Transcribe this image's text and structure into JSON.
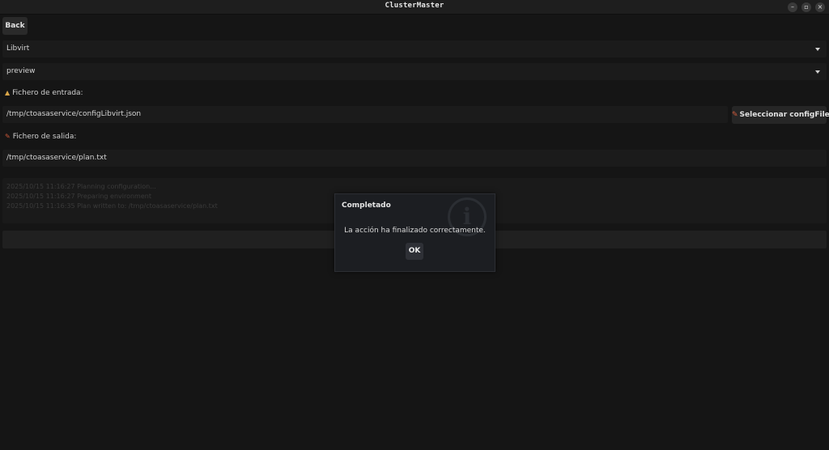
{
  "window": {
    "title": "ClusterMaster",
    "minimize_glyph": "–",
    "maximize_glyph": "▫",
    "close_glyph": "×"
  },
  "toolbar": {
    "back_label": "Back"
  },
  "form": {
    "provider_select": {
      "selected": "Libvirt"
    },
    "mode_select": {
      "selected": "preview"
    },
    "input_label": "Fichero de entrada:",
    "input_icon": "download-icon",
    "input_path": "/tmp/ctoasaservice/configLibvirt.json",
    "select_config_label": "Seleccionar configFile",
    "output_label": "Fichero de salida:",
    "output_icon": "pencil-icon",
    "output_path": "/tmp/ctoasaservice/plan.txt"
  },
  "log": {
    "lines": [
      "2025/10/15 11:16:27 Planning configuration...",
      "2025/10/15 11:16:27 Preparing environment",
      "2025/10/15 11:16:35 Plan written to: /tmp/ctoasaservice/plan.txt"
    ]
  },
  "dialog": {
    "title": "Completado",
    "message": "La acción ha finalizado correctamente.",
    "ok_label": "OK",
    "icon": "info-icon"
  },
  "colors": {
    "background": "#151515",
    "dialog_bg": "#1c1e22",
    "accent_icon_input": "#d9a648",
    "accent_icon_output": "#d05a3a"
  }
}
